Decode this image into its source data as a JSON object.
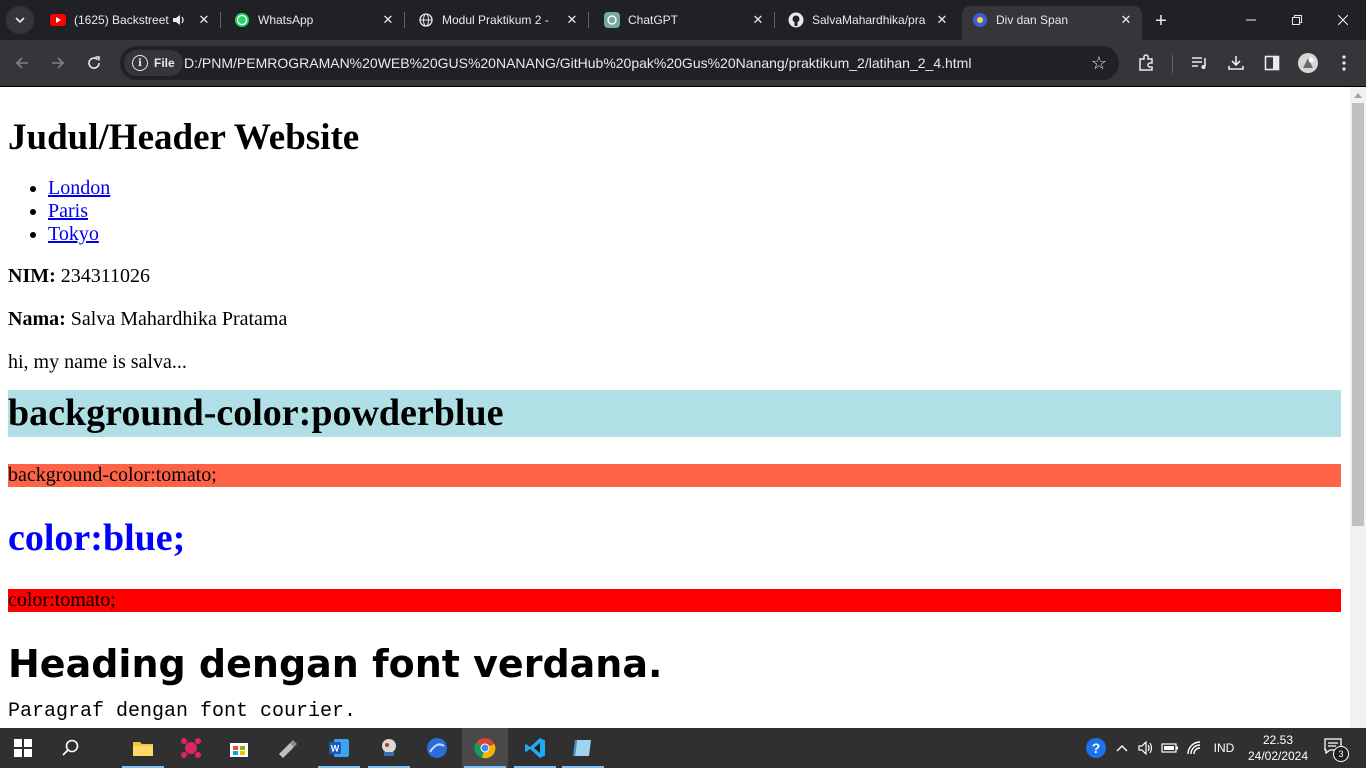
{
  "tabs": [
    {
      "title": "(1625) Backstreet",
      "icon": "youtube-icon",
      "muted_icon": "speaker-icon",
      "active": false
    },
    {
      "title": "WhatsApp",
      "icon": "whatsapp-icon",
      "active": false
    },
    {
      "title": "Modul Praktikum 2 - ",
      "icon": "globe-icon",
      "active": false
    },
    {
      "title": "ChatGPT",
      "icon": "chatgpt-icon",
      "active": false
    },
    {
      "title": "SalvaMahardhika/pra",
      "icon": "github-icon",
      "active": false
    },
    {
      "title": "Div dan Span",
      "icon": "globe-icon",
      "active": true
    }
  ],
  "toolbar": {
    "site_chip": "File",
    "url": "D:/PNM/PEMROGRAMAN%20WEB%20GUS%20NANANG/GitHub%20pak%20Gus%20Nanang/praktikum_2/latihan_2_4.html"
  },
  "page": {
    "header": "Judul/Header Website",
    "links": [
      "London",
      "Paris",
      "Tokyo"
    ],
    "nim_label": "NIM:",
    "nim_value": " 234311026",
    "nama_label": "Nama:",
    "nama_value": " Salva Mahardhika Pratama",
    "intro": "hi, my name is salva...",
    "powder_heading": "background-color:powderblue",
    "tomato_para": "background-color:tomato;",
    "blue_heading": "color:blue;",
    "red_para": "color:tomato;",
    "verdana_heading": "Heading dengan font verdana.",
    "courier_para": "Paragraf dengan font courier."
  },
  "taskbar": {
    "apps": [
      "windows-start-icon",
      "search-icon",
      "file-explorer-icon",
      "app-icon",
      "microsoft-store-icon",
      "usb-icon",
      "word-icon",
      "app-icon",
      "app-icon",
      "chrome-icon",
      "vscode-icon",
      "app-icon"
    ],
    "language": "IND",
    "time": "22.53",
    "date": "24/02/2024",
    "notification_count": "3"
  },
  "colors": {
    "powderblue": "#b0e0e6",
    "tomato": "#ff6347",
    "red": "#ff0000",
    "blue": "#0000ff",
    "link": "#0000ee"
  }
}
